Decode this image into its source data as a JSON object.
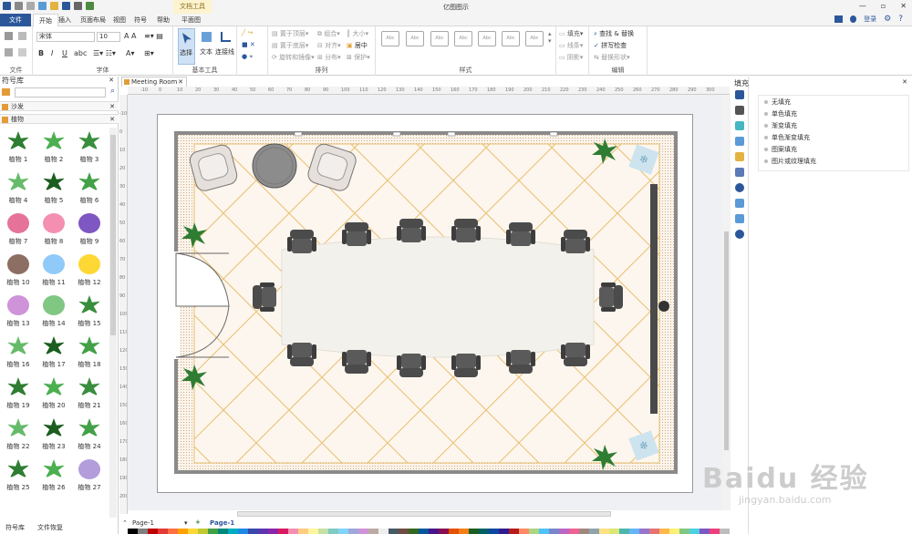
{
  "window": {
    "title": "亿图图示",
    "context_tab_title": "文档工具",
    "controls": [
      "—",
      "▫",
      "✕"
    ]
  },
  "menu": {
    "file": "文件",
    "items": [
      "开始",
      "插入",
      "页面布局",
      "视图",
      "符号",
      "帮助",
      "平面图"
    ],
    "login": "登录"
  },
  "ribbon": {
    "font": {
      "family": "宋体",
      "size": "10",
      "label": "字体"
    },
    "file_label": "文件",
    "basic_tools": {
      "select": "选择",
      "text": "文本",
      "connector": "连接线",
      "label": "基本工具"
    },
    "arrange": {
      "bring_front": "置于顶层",
      "send_back": "置于底层",
      "rotate": "旋转和镜像",
      "group": "组合",
      "align": "对齐",
      "distribute": "分布",
      "size": "大小",
      "center": "居中",
      "protect": "保护",
      "label": "排列"
    },
    "styles": {
      "thumb": "Abc",
      "label": "样式",
      "count": 7
    },
    "fill_line": {
      "fill": "填充",
      "line": "线条",
      "shadow": "阴影"
    },
    "edit": {
      "find_replace": "查找 & 替换",
      "spell": "拼写检查",
      "replace_shape": "替换形状",
      "label": "编辑"
    }
  },
  "library": {
    "title": "符号库",
    "categories": [
      "沙发",
      "植物"
    ],
    "items": [
      "植物 1",
      "植物 2",
      "植物 3",
      "植物 4",
      "植物 5",
      "植物 6",
      "植物 7",
      "植物 8",
      "植物 9",
      "植物 10",
      "植物 11",
      "植物 12",
      "植物 13",
      "植物 14",
      "植物 15",
      "植物 16",
      "植物 17",
      "植物 18",
      "植物 19",
      "植物 20",
      "植物 21",
      "植物 22",
      "植物 23",
      "植物 24",
      "植物 25",
      "植物 26",
      "植物 27"
    ],
    "bottom_tabs": [
      "符号库",
      "文件恢复"
    ]
  },
  "document": {
    "tab": "Meeting Room",
    "pages": [
      "Page-1"
    ],
    "active_page": "Page-1",
    "ruler_ticks": [
      "-10",
      "0",
      "10",
      "20",
      "30",
      "40",
      "50",
      "60",
      "70",
      "80",
      "90",
      "100",
      "110",
      "120",
      "130",
      "140",
      "150",
      "160",
      "170",
      "180",
      "190",
      "200",
      "210",
      "220",
      "230",
      "240",
      "250",
      "260",
      "270",
      "280",
      "290",
      "300"
    ]
  },
  "fill_panel": {
    "title": "填充",
    "options": [
      "无填充",
      "单色填充",
      "渐变填充",
      "单色渐变填充",
      "图案填充",
      "图片或纹理填充"
    ]
  },
  "watermark": {
    "brand": "Baidu 经验",
    "url": "jingyan.baidu.com"
  },
  "colors": {
    "accent": "#2b579a",
    "wall": "#8a8a8a",
    "floor": "#fdf6ee",
    "grid": "#e8c070",
    "chair": "#4b4b4b",
    "table": "#f3f1ec",
    "plant": "#2e7d32"
  }
}
